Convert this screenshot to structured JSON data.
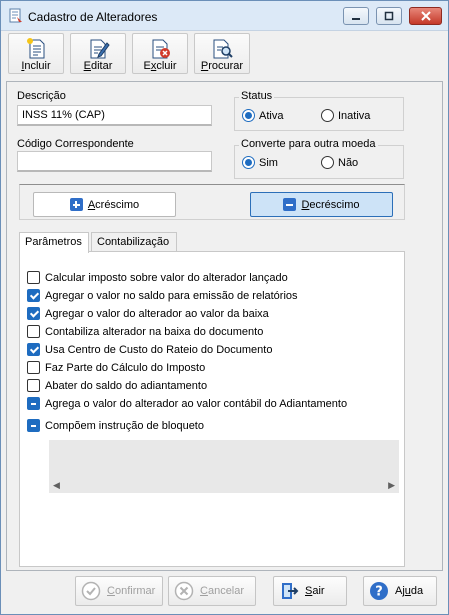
{
  "window": {
    "title": "Cadastro de Alteradores"
  },
  "toolbar": {
    "incluir": {
      "prefix": "",
      "accel": "I",
      "rest": "ncluir"
    },
    "editar": {
      "prefix": "",
      "accel": "E",
      "rest": "ditar"
    },
    "excluir": {
      "prefix": "E",
      "accel": "x",
      "rest": "cluir"
    },
    "procurar": {
      "prefix": "",
      "accel": "P",
      "rest": "rocurar"
    }
  },
  "form": {
    "descricao_label": "Descrição",
    "descricao_value": "INSS 11% (CAP)",
    "codigo_label": "Código Correspondente",
    "codigo_value": "",
    "status": {
      "title": "Status",
      "options": [
        "Ativa",
        "Inativa"
      ],
      "selected": "Ativa"
    },
    "converte": {
      "title": "Converte para outra moeda",
      "options": [
        "Sim",
        "Não"
      ],
      "selected": "Sim"
    }
  },
  "mode": {
    "acrescimo": {
      "accel": "A",
      "rest": "créscimo"
    },
    "decrescimo": {
      "accel": "D",
      "rest": "ecréscimo"
    },
    "selected": "Decréscimo"
  },
  "tabs": [
    "Parâmetros",
    "Contabilização"
  ],
  "parametros": [
    {
      "label": "Calcular imposto sobre valor do alterador lançado",
      "state": "unchecked"
    },
    {
      "label": "Agregar o valor no saldo para emissão de relatórios",
      "state": "checked"
    },
    {
      "label": "Agregar o valor do alterador ao valor da baixa",
      "state": "checked"
    },
    {
      "label": "Contabiliza alterador na baixa do documento",
      "state": "unchecked"
    },
    {
      "label": "Usa Centro de Custo do Rateio do Documento",
      "state": "checked"
    },
    {
      "label": "Faz Parte do Cálculo do Imposto",
      "state": "unchecked"
    },
    {
      "label": "Abater do saldo do adiantamento",
      "state": "unchecked"
    },
    {
      "label": "Agrega o valor do alterador ao valor contábil do Adiantamento",
      "state": "indeterminate"
    },
    {
      "label": "Compõem instrução de bloqueto",
      "state": "indeterminate"
    }
  ],
  "footer": {
    "confirmar": {
      "accel": "C",
      "rest": "onfirmar"
    },
    "cancelar": {
      "accel": "C",
      "rest": "ancelar"
    },
    "sair": {
      "accel": "S",
      "rest": "air"
    },
    "ajuda": {
      "prefix": "Aj",
      "accel": "u",
      "rest": "da"
    }
  },
  "colors": {
    "accent": "#1e6cc0",
    "selected_button_bg": "#cde3f7",
    "selected_button_border": "#2c6fb8"
  },
  "icons": [
    "app-icon",
    "minimize-icon",
    "maximize-icon",
    "close-icon",
    "new-document-icon",
    "edit-icon",
    "delete-icon",
    "search-icon",
    "plus-icon",
    "minus-icon",
    "check-icon",
    "cancel-icon",
    "exit-icon",
    "help-icon"
  ]
}
